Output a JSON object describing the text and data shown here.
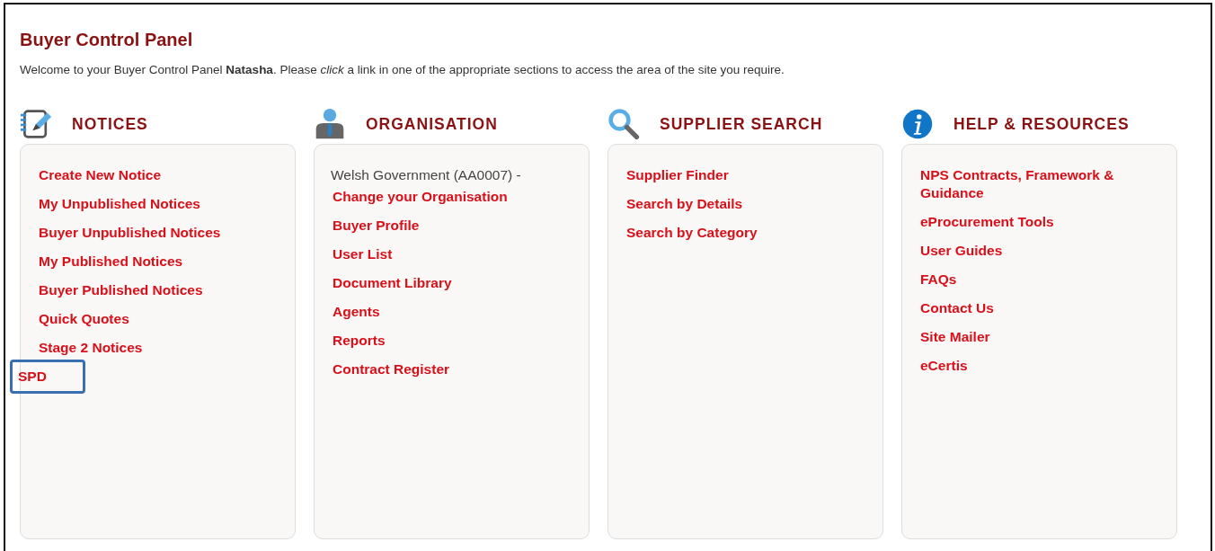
{
  "title": "Buyer Control Panel",
  "welcome": "Welcome to your Buyer Control Panel **Natasha**. Please *click* a link in one of the appropriate sections to access the area of the site you require.",
  "sections": [
    {
      "heading": "NOTICES",
      "items": [
        {
          "kind": "link",
          "text": "Create New Notice",
          "highlighted": false
        },
        {
          "kind": "link",
          "text": "My Unpublished Notices",
          "highlighted": false
        },
        {
          "kind": "link",
          "text": "Buyer Unpublished Notices",
          "highlighted": false
        },
        {
          "kind": "link",
          "text": "My Published Notices",
          "highlighted": false
        },
        {
          "kind": "link",
          "text": "Buyer Published Notices",
          "highlighted": false
        },
        {
          "kind": "link",
          "text": "Quick Quotes",
          "highlighted": false
        },
        {
          "kind": "link",
          "text": "Stage 2 Notices",
          "highlighted": false
        },
        {
          "kind": "link",
          "text": "SPD",
          "highlighted": true
        }
      ]
    },
    {
      "heading": "ORGANISATION",
      "items": [
        {
          "kind": "text",
          "text": "Welsh Government (AA0007) -"
        },
        {
          "kind": "link",
          "text": "Change your Organisation",
          "highlighted": false
        },
        {
          "kind": "link",
          "text": "Buyer Profile",
          "highlighted": false
        },
        {
          "kind": "link",
          "text": "User List",
          "highlighted": false
        },
        {
          "kind": "link",
          "text": "Document Library",
          "highlighted": false
        },
        {
          "kind": "link",
          "text": "Agents",
          "highlighted": false
        },
        {
          "kind": "link",
          "text": "Reports",
          "highlighted": false
        },
        {
          "kind": "link",
          "text": "Contract Register",
          "highlighted": false
        }
      ]
    },
    {
      "heading": "SUPPLIER SEARCH",
      "items": [
        {
          "kind": "link",
          "text": "Supplier Finder",
          "highlighted": false
        },
        {
          "kind": "link",
          "text": "Search by Details",
          "highlighted": false
        },
        {
          "kind": "link",
          "text": "Search by Category",
          "highlighted": false
        }
      ]
    },
    {
      "heading": "HELP & RESOURCES",
      "items": [
        {
          "kind": "link",
          "text": "NPS Contracts, Framework & Guidance",
          "highlighted": false
        },
        {
          "kind": "link",
          "text": "eProcurement Tools",
          "highlighted": false
        },
        {
          "kind": "link",
          "text": "User Guides",
          "highlighted": false
        },
        {
          "kind": "link",
          "text": "FAQs",
          "highlighted": false
        },
        {
          "kind": "link",
          "text": "Contact Us",
          "highlighted": false
        },
        {
          "kind": "link",
          "text": "Site Mailer",
          "highlighted": false
        },
        {
          "kind": "link",
          "text": "eCertis",
          "highlighted": false
        }
      ]
    }
  ]
}
